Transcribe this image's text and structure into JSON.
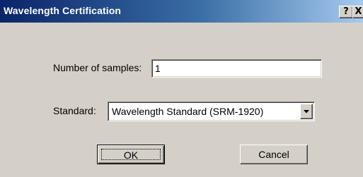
{
  "window": {
    "title": "Wavelength Certification",
    "help_glyph": "?",
    "close_glyph": "X"
  },
  "form": {
    "samples_label": "Number of samples:",
    "samples_value": "1",
    "standard_label": "Standard:",
    "standard_value": "Wavelength Standard (SRM-1920)"
  },
  "buttons": {
    "ok": "OK",
    "cancel": "Cancel"
  },
  "icons": {
    "dropdown": "chevron-down-icon"
  }
}
